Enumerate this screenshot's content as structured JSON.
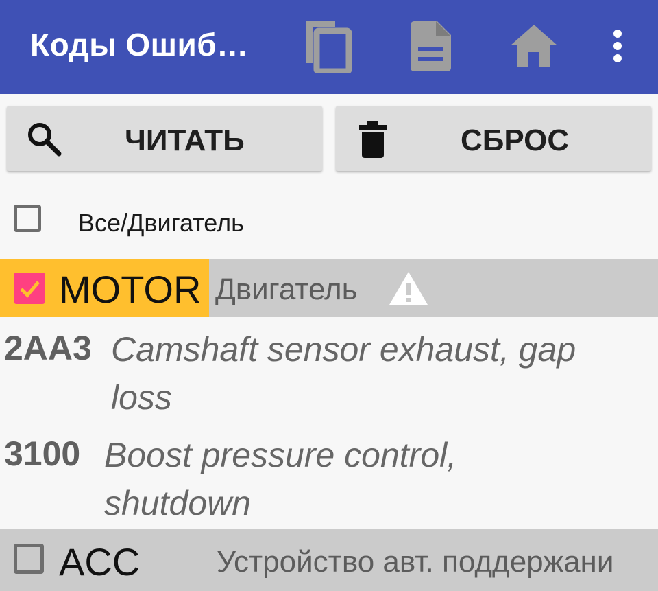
{
  "appbar": {
    "title": "Коды Ошиб…",
    "actions": [
      {
        "icon": "copy-icon"
      },
      {
        "icon": "document-icon"
      },
      {
        "icon": "home-icon"
      },
      {
        "icon": "more-vert-icon"
      }
    ],
    "background": "#3f51b5"
  },
  "buttons": {
    "read": {
      "label": "ЧИТАТЬ",
      "icon": "search-icon"
    },
    "reset": {
      "label": "СБРОС",
      "icon": "trash-icon"
    }
  },
  "select_all": {
    "label": "Все/Двигатель",
    "checked": false
  },
  "groups": [
    {
      "code": "MOTOR",
      "name": "Двигатель",
      "checked": true,
      "warning": true,
      "highlight_color": "#ffbf2e",
      "checkbox_color": "#ff4081",
      "errors": [
        {
          "code": "2AA3",
          "description": "Camshaft sensor exhaust, gap loss"
        },
        {
          "code": "3100",
          "description": "Boost pressure control, shutdown"
        }
      ]
    },
    {
      "code": "ACC",
      "name": "Устройство авт. поддержани",
      "checked": false,
      "warning": false
    }
  ]
}
